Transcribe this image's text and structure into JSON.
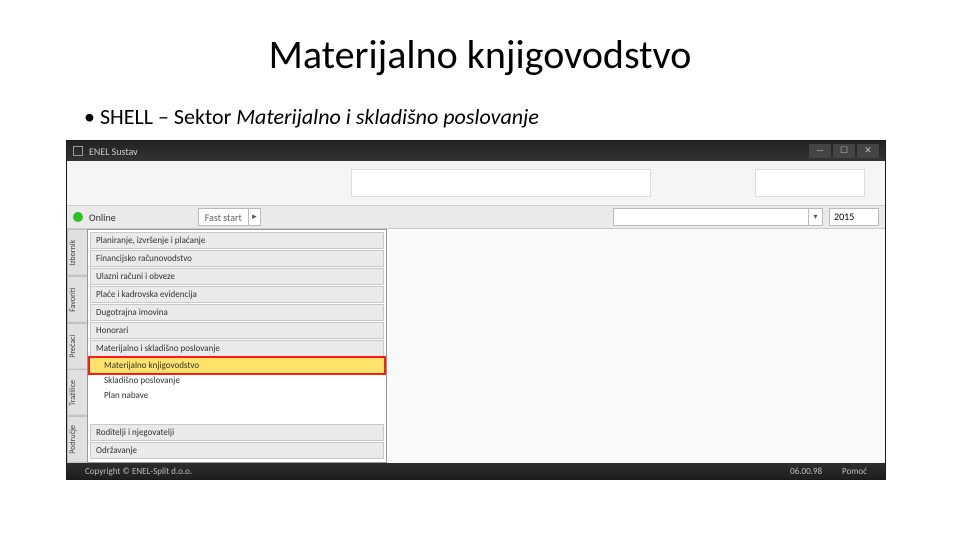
{
  "slide": {
    "title": "Materijalno knjigovodstvo",
    "bullet_prefix": "SHELL – Sektor ",
    "bullet_italic": "Materijalno i skladišno poslovanje"
  },
  "app": {
    "title": "ENEL Sustav",
    "window_buttons": {
      "min": "—",
      "max": "☐",
      "close": "✕"
    },
    "status": {
      "text": "Online"
    },
    "fast_start": {
      "label": "Fast start",
      "arrow": "▸"
    },
    "year": "2015",
    "side_tabs": [
      "Izbornik",
      "Favoriti",
      "Prečaci",
      "Tražilice",
      "Područje"
    ],
    "tree": {
      "top": [
        "Planiranje, izvršenje i plaćanje",
        "Financijsko računovodstvo",
        "Ulazni računi i obveze",
        "Plaće i kadrovska evidencija",
        "Dugotrajna imovina",
        "Honorari",
        "Materijalno i skladišno poslovanje"
      ],
      "sub": [
        {
          "label": "Materijalno knjigovodstvo",
          "selected": true
        },
        {
          "label": "Skladišno poslovanje",
          "selected": false
        },
        {
          "label": "Plan nabave",
          "selected": false
        }
      ],
      "bottom": [
        "Roditelji i njegovatelji",
        "Održavanje"
      ]
    },
    "statusbar": {
      "left": "Copyright © ENEL-Split d.o.o.",
      "time": "06.00.98",
      "help": "Pomoć"
    }
  }
}
